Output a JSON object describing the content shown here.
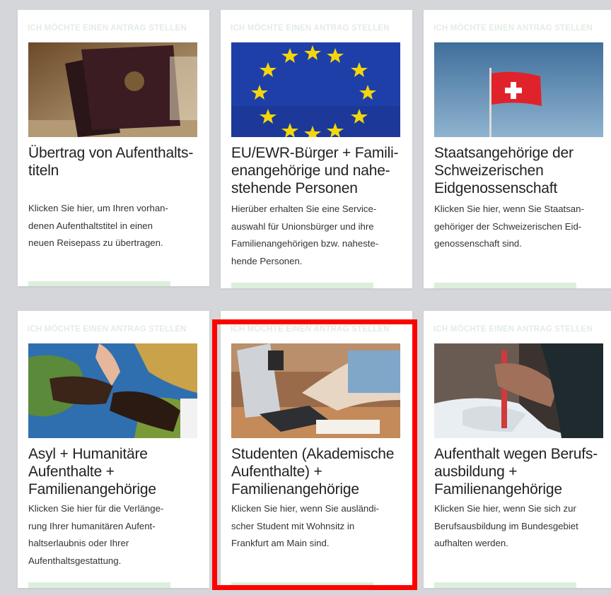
{
  "cards": [
    {
      "eyebrow": "ICH MÖCHTE EINEN ANTRAG STELLEN",
      "image": "passports-photo",
      "title": "Übertrag von Aufenthalts-\ntiteln",
      "desc": "Klicken Sie hier, um Ihren vorhan-\ndenen Aufenthaltstitel in einen\nneuen Reisepass zu übertragen."
    },
    {
      "eyebrow": "ICH MÖCHTE EINEN ANTRAG STELLEN",
      "image": "eu-flag-photo",
      "title": "EU/EWR-Bürger + Famili-\nenangehörige und nahe-\nstehende Personen",
      "desc": "Hierüber erhalten Sie eine Service-\nauswahl für Unionsbürger und ihre\nFamilienangehörigen bzw. naheste-\nhende Personen."
    },
    {
      "eyebrow": "ICH MÖCHTE EINEN ANTRAG STELLEN",
      "image": "swiss-flag-photo",
      "title": "Staatsangehörige der\nSchweizerischen\nEidgenossenschaft",
      "desc": "Klicken Sie hier, wenn Sie Staatsan-\ngehöriger der Schweizerischen Eid-\ngenossenschaft sind."
    },
    {
      "eyebrow": "ICH MÖCHTE EINEN ANTRAG STELLEN",
      "image": "hands-on-globe-photo",
      "title": "Asyl + Humanitäre\nAufenthalte +\nFamilienangehörige",
      "desc": "Klicken Sie hier für die Verlänge-\nrung Ihrer humanitären Aufent-\nhaltserlaubnis oder Ihrer\nAufenthaltsgestattung."
    },
    {
      "eyebrow": "ICH MÖCHTE EINEN ANTRAG STELLEN",
      "image": "student-laptop-photo",
      "title": "Studenten (Akademische\nAufenthalte) +\nFamilienangehörige",
      "desc": "Klicken Sie hier, wenn Sie ausländi-\nscher Student mit Wohnsitz in\nFrankfurt am Main sind."
    },
    {
      "eyebrow": "ICH MÖCHTE EINEN ANTRAG STELLEN",
      "image": "apprentice-sculpting-photo",
      "title": "Aufenthalt wegen Berufs-\nausbildung +\nFamilienangehörige",
      "desc": "Klicken Sie hier, wenn Sie sich zur\nBerufsausbildung im Bundesgebiet\naufhalten werden."
    }
  ],
  "colors": {
    "page_bg": "#d4d6da",
    "card_bg": "#ffffff",
    "highlight": "#ff0000",
    "cta_green": "#dcefdc"
  }
}
